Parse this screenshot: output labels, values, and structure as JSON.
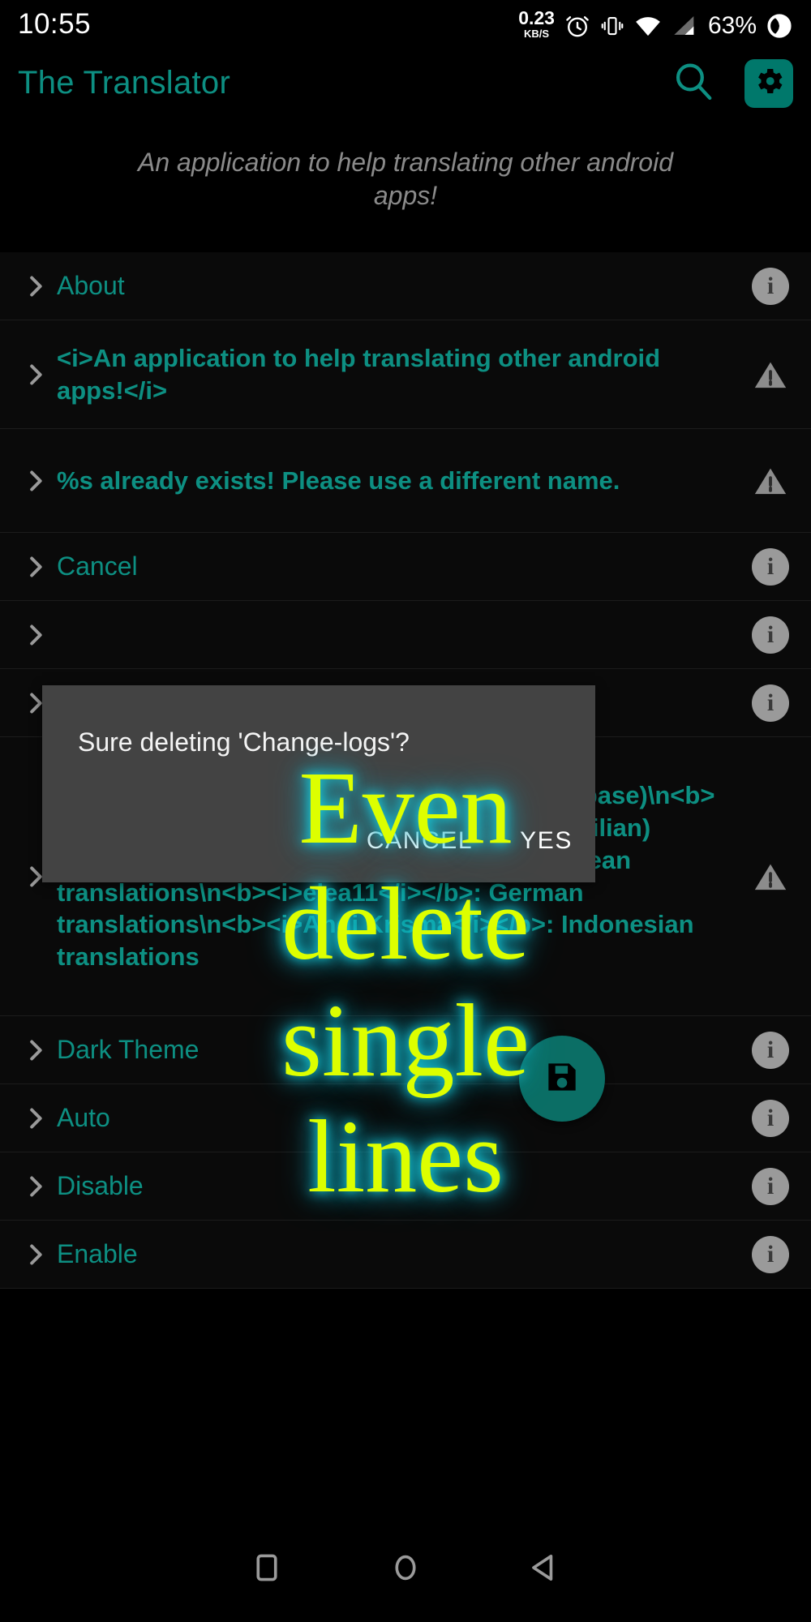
{
  "statusbar": {
    "time": "10:55",
    "net_rate": "0.23",
    "net_unit": "KB/S",
    "alarm_icon": "alarm-icon",
    "vibrate_icon": "vibrate-icon",
    "wifi_icon": "wifi-icon",
    "signal_icon": "cellular-signal-icon",
    "battery_percent": "63%",
    "battery_icon": "battery-circle-icon"
  },
  "appbar": {
    "title": "The Translator",
    "search_icon": "search-icon",
    "settings_icon": "gear-icon"
  },
  "subtitle": "An application to help translating other android apps!",
  "colors": {
    "accent_teal": "#0d8f82",
    "gear_box": "#00786b",
    "fab": "#0b6e65",
    "dialog_bg": "#434343",
    "overlay_yellow": "#ddff00",
    "overlay_glow": "#16d6e6",
    "row_bg": "#0a0a0a",
    "divider": "#1c1c1c"
  },
  "list": {
    "rows": [
      {
        "label": "About",
        "end_icon": "info-icon",
        "style": "plain"
      },
      {
        "label": "<i>An application to help translating other android apps!</i>",
        "end_icon": "warning-icon",
        "style": "bold"
      },
      {
        "label": "%s already exists! Please use a different name.",
        "end_icon": "warning-icon",
        "style": "bold"
      },
      {
        "label": "Cancel",
        "end_icon": "info-icon",
        "style": "plain"
      },
      {
        "label": "",
        "end_icon": "info-icon",
        "style": "plain"
      },
      {
        "label": "",
        "end_icon": "info-icon",
        "style": "plain"
      },
      {
        "label": "<b><i>Grarak</i></b>: KernelAdiutor (Code base)\\n<b><i>Lennoard Silva</i></b>: Portuguese (Brazilian) translations\\n<b><i>Festa Luke</i></b>: Korean translations\\n<b><i>elea11</i></b>: German translations\\n<b><i>Andi Krisma</i></b>: Indonesian translations",
        "end_icon": "warning-icon",
        "style": "bold"
      },
      {
        "label": "Dark Theme",
        "end_icon": "info-icon",
        "style": "plain"
      },
      {
        "label": "Auto",
        "end_icon": "info-icon",
        "style": "plain"
      },
      {
        "label": "Disable",
        "end_icon": "info-icon",
        "style": "plain"
      },
      {
        "label": "Enable",
        "end_icon": "info-icon",
        "style": "plain"
      }
    ]
  },
  "dialog": {
    "message": "Sure deleting 'Change-logs'?",
    "cancel_label": "CANCEL",
    "yes_label": "YES"
  },
  "fab": {
    "icon": "save-floppy-icon"
  },
  "overlay": {
    "lines": [
      "Even",
      "delete",
      "single",
      "lines"
    ]
  },
  "navbar": {
    "recents_icon": "recents-square-icon",
    "home_icon": "home-circle-icon",
    "back_icon": "back-triangle-icon"
  }
}
